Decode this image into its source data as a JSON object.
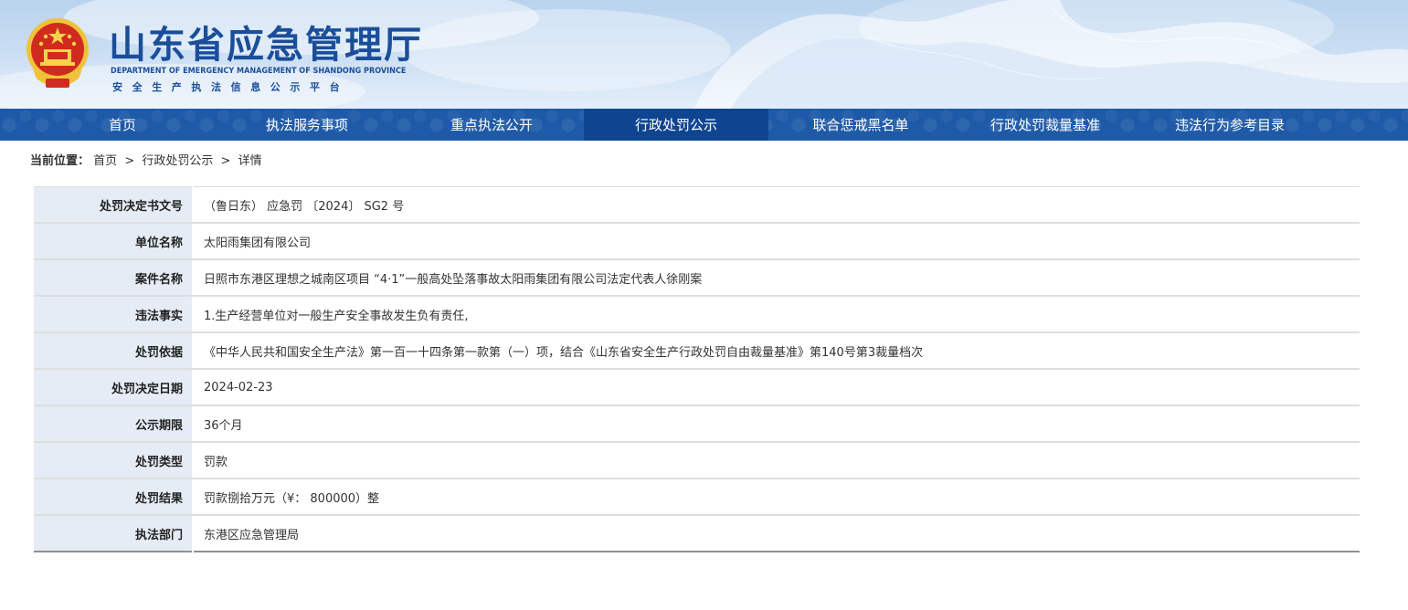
{
  "header": {
    "title": "山东省应急管理厅",
    "title_en": "DEPARTMENT OF EMERGENCY MANAGEMENT OF SHANDONG PROVINCE",
    "subtitle": "安全生产执法信息公示平台",
    "emblem_icon": "national-emblem-icon"
  },
  "nav": {
    "items": [
      {
        "label": "首页",
        "active": false
      },
      {
        "label": "执法服务事项",
        "active": false
      },
      {
        "label": "重点执法公开",
        "active": false
      },
      {
        "label": "行政处罚公示",
        "active": true
      },
      {
        "label": "联合惩戒黑名单",
        "active": false
      },
      {
        "label": "行政处罚裁量基准",
        "active": false
      },
      {
        "label": "违法行为参考目录",
        "active": false
      }
    ]
  },
  "breadcrumb": {
    "label": "当前位置：",
    "items": [
      "首页",
      "行政处罚公示",
      "详情"
    ],
    "separator": ">"
  },
  "detail": {
    "rows": [
      {
        "label": "处罚决定书文号",
        "value": "（鲁日东） 应急罚 〔2024〕 SG2 号"
      },
      {
        "label": "单位名称",
        "value": "太阳雨集团有限公司"
      },
      {
        "label": "案件名称",
        "value": "日照市东港区理想之城南区项目 “4·1”一般高处坠落事故太阳雨集团有限公司法定代表人徐刚案"
      },
      {
        "label": "违法事实",
        "value": "1.生产经营单位对一般生产安全事故发生负有责任,"
      },
      {
        "label": "处罚依据",
        "value": "《中华人民共和国安全生产法》第一百一十四条第一款第（一）项，结合《山东省安全生产行政处罚自由裁量基准》第140号第3裁量档次"
      },
      {
        "label": "处罚决定日期",
        "value": "2024-02-23"
      },
      {
        "label": "公示期限",
        "value": "36个月"
      },
      {
        "label": "处罚类型",
        "value": "罚款"
      },
      {
        "label": "处罚结果",
        "value": "罚款捌拾万元（¥： 800000）整"
      },
      {
        "label": "执法部门",
        "value": "东港区应急管理局"
      }
    ]
  },
  "colors": {
    "nav_bg": "#1e5aa8",
    "nav_active_bg": "#0f4590",
    "title_blue": "#1b4e9a",
    "label_bg": "#e6ecf6"
  }
}
